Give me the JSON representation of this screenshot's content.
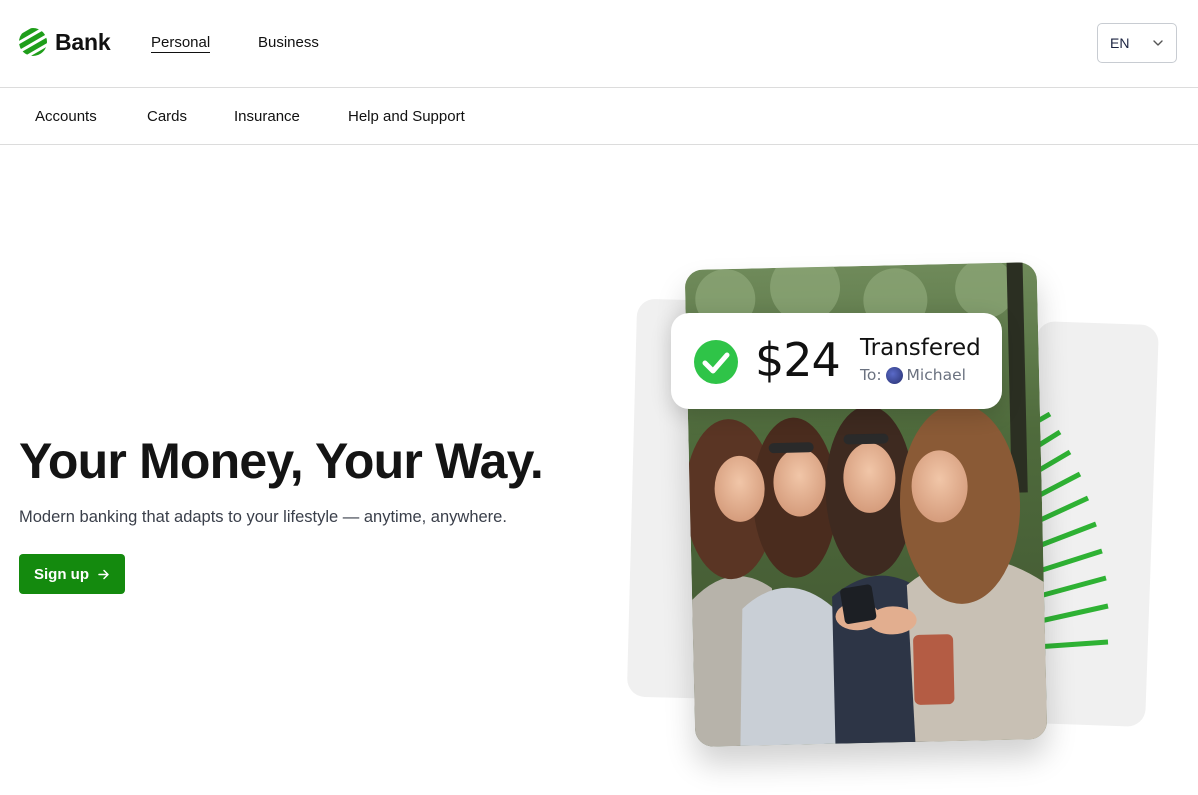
{
  "brand": {
    "name": "Bank",
    "color": "#1f9e1a"
  },
  "header": {
    "nav": [
      {
        "label": "Personal",
        "active": true
      },
      {
        "label": "Business",
        "active": false
      }
    ],
    "language": "EN"
  },
  "subnav": {
    "items": [
      "Accounts",
      "Cards",
      "Insurance",
      "Help and Support"
    ]
  },
  "hero": {
    "title": "Your Money, Your Way.",
    "subtitle": "Modern banking that adapts to your lifestyle — anytime, anywhere.",
    "cta_label": "Sign up",
    "cta_color": "#148a0e"
  },
  "transfer_card": {
    "amount": "$24",
    "status": "Transfered",
    "to_prefix": "To:",
    "recipient": "Michael",
    "check_color": "#2fc448"
  },
  "hero_image": {
    "description_icon": "people-with-phone-photo"
  }
}
